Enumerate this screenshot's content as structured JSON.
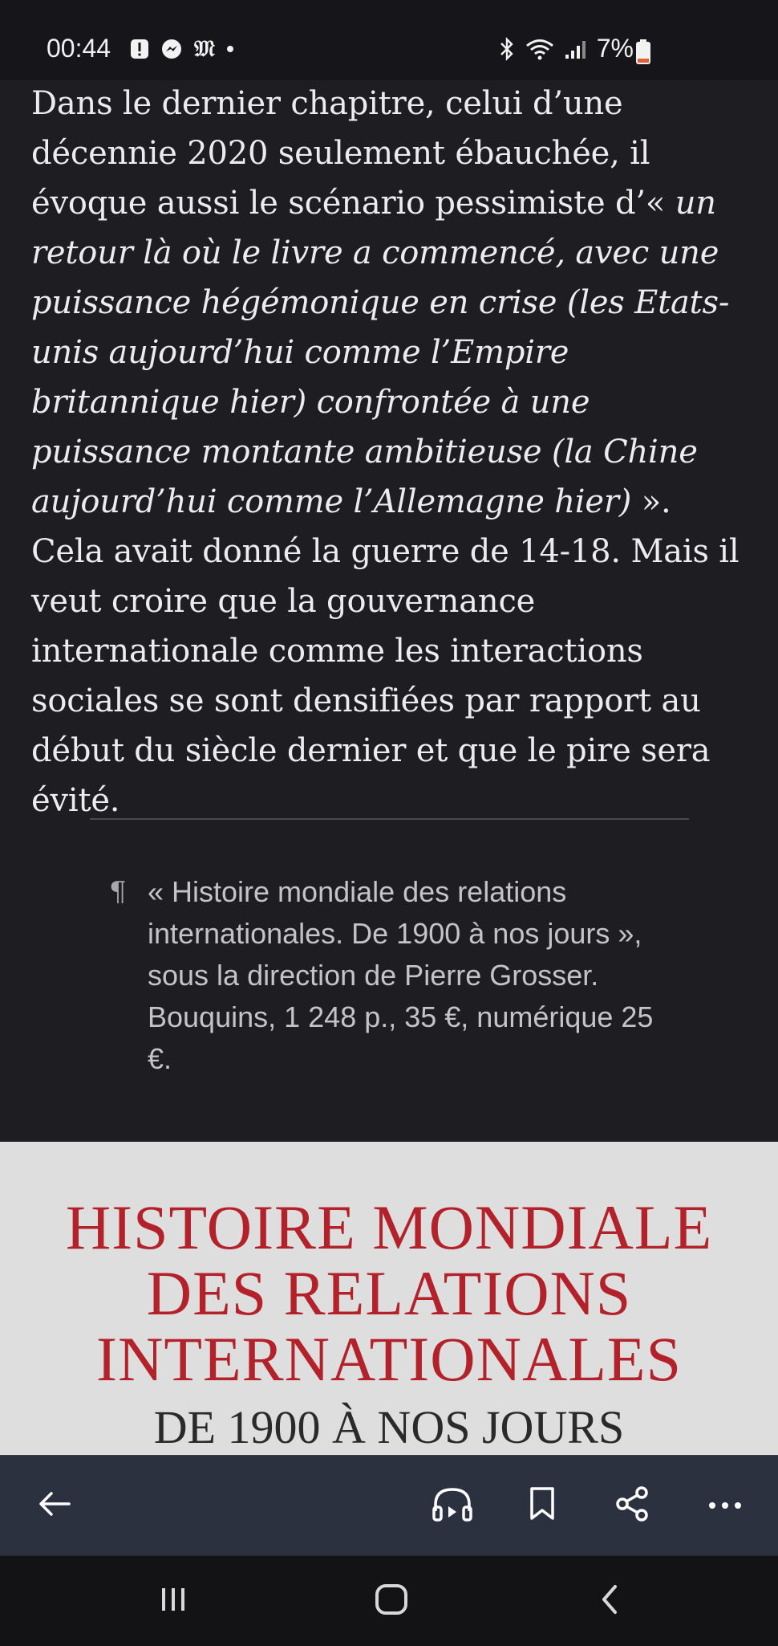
{
  "status_bar": {
    "time": "00:44",
    "battery": "7%",
    "left_icons": [
      "alert-icon",
      "messenger-icon",
      "le-monde-icon",
      "dot-icon"
    ],
    "right_icons": [
      "bluetooth-icon",
      "wifi-icon",
      "signal-icon",
      "battery-icon"
    ]
  },
  "article": {
    "p1_start": "Dans le dernier chapitre, celui d’une décennie 2020 seulement ébauchée, il évoque aussi le scénario pessimiste d’« ",
    "p1_quote": "un retour là où le livre a commencé, avec une puissance hégémonique en crise (les Etats-unis aujourd’hui comme l’Empire britannique hier) confrontée à une puissance montante ambitieuse (la Chine aujourd’hui comme l’Allemagne hier)",
    "p1_end": " ». Cela avait donné la guerre de 14-18. Mais il veut croire que la gouvernance internationale comme les interactions sociales se sont densifiées par rapport au début du siècle dernier et que le pire sera évité."
  },
  "note": {
    "symbol": "¶",
    "text": "« Histoire mondiale des relations internationales. De 1900 à nos jours », sous la direction de Pierre Grosser. Bouquins, 1 248 p., 35 €, numérique 25 €."
  },
  "cover": {
    "title_line1": "HISTOIRE MONDIALE",
    "title_line2": "DES RELATIONS",
    "title_line3": "INTERNATIONALES",
    "subtitle": "DE 1900 À NOS JOURS",
    "title_color": "#b3222a"
  },
  "app_bar": {
    "buttons": [
      "back-arrow-icon",
      "headphones-icon",
      "bookmark-icon",
      "share-icon",
      "more-icon"
    ]
  },
  "nav_bar": {
    "buttons": [
      "recent-apps-icon",
      "home-icon",
      "back-icon"
    ]
  }
}
